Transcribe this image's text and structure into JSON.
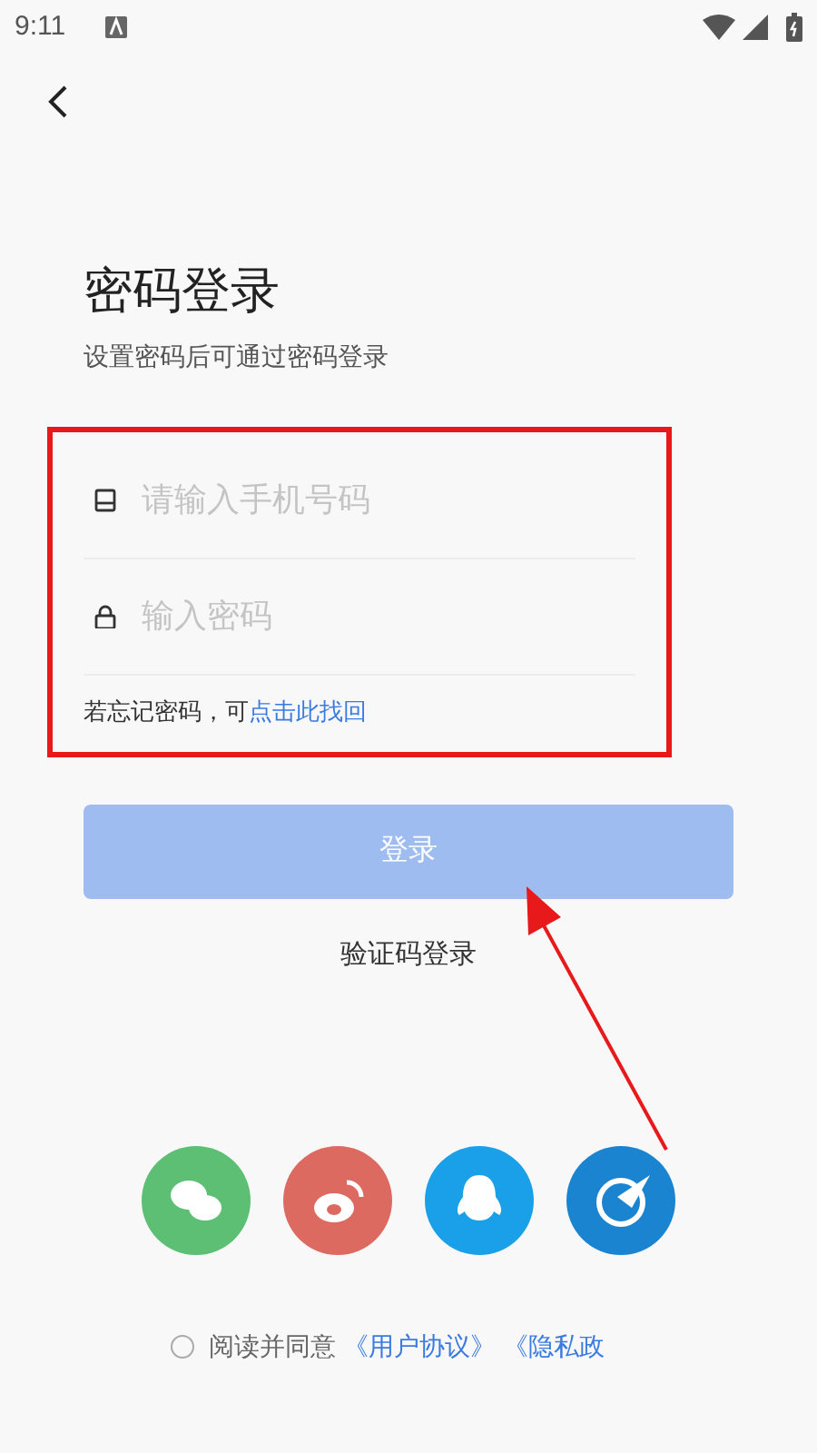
{
  "status_bar": {
    "time": "9:11"
  },
  "title": "密码登录",
  "subtitle": "设置密码后可通过密码登录",
  "fields": [
    {
      "kind": "phone",
      "placeholder": "请输入手机号码"
    },
    {
      "kind": "password",
      "placeholder": "输入密码"
    }
  ],
  "forgot": {
    "text": "若忘记密码，可",
    "link": "点击此找回"
  },
  "login_button": {
    "label": "登录",
    "disabled": true
  },
  "alt_login": "验证码登录",
  "social": [
    {
      "kind": "wechat",
      "color": "#5cbf73"
    },
    {
      "kind": "weibo",
      "color": "#dc6a60"
    },
    {
      "kind": "qq",
      "color": "#1aa0e8"
    },
    {
      "kind": "plane",
      "color": "#1a84d0"
    }
  ],
  "agreement": {
    "checked": false,
    "text": "阅读并同意",
    "links": [
      "《用户协议》",
      "《隐私政"
    ]
  }
}
